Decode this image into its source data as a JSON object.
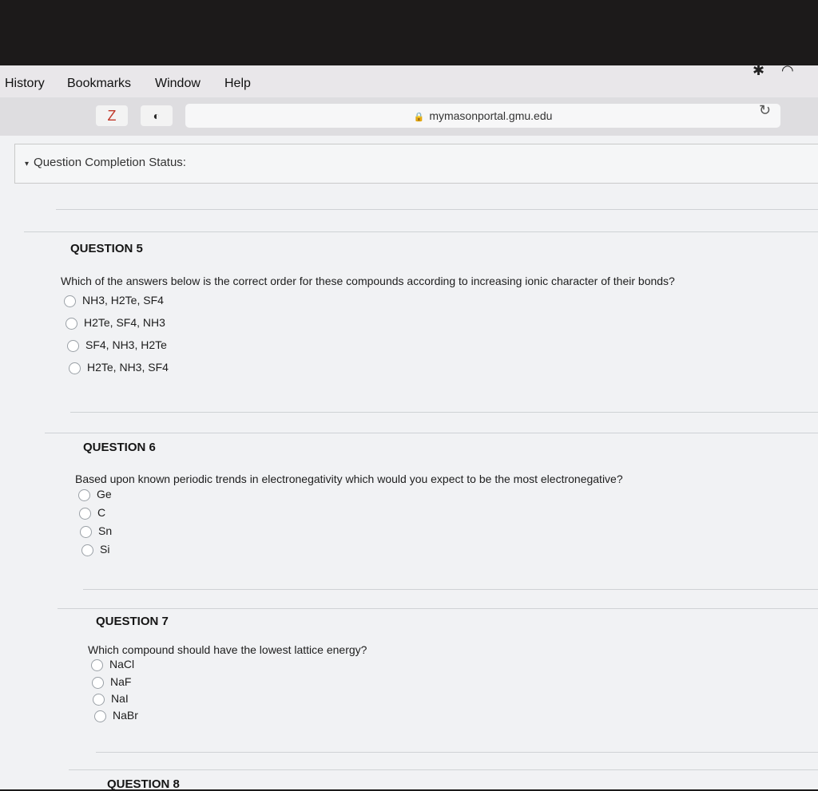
{
  "menu": [
    "History",
    "Bookmarks",
    "Window",
    "Help"
  ],
  "toolbar": {
    "tab1": "Z",
    "tab2": "◐",
    "url": "mymasonportal.gmu.edu",
    "lock": "🔒"
  },
  "completion_label": "Question Completion Status:",
  "questions": [
    {
      "title": "QUESTION 5",
      "text": "Which of the answers below is the correct order for these compounds according to increasing ionic character of their bonds?",
      "options": [
        "NH3, H2Te, SF4",
        "H2Te, SF4, NH3",
        "SF4, NH3, H2Te",
        "H2Te, NH3, SF4"
      ]
    },
    {
      "title": "QUESTION 6",
      "text": "Based upon known periodic trends in electronegativity which would you expect to be the most electronegative?",
      "options": [
        "Ge",
        "C",
        "Sn",
        "Si"
      ]
    },
    {
      "title": "QUESTION 7",
      "text": "Which compound should have the lowest lattice energy?",
      "options": [
        "NaCl",
        "NaF",
        "NaI",
        "NaBr"
      ]
    },
    {
      "title": "QUESTION 8"
    }
  ]
}
